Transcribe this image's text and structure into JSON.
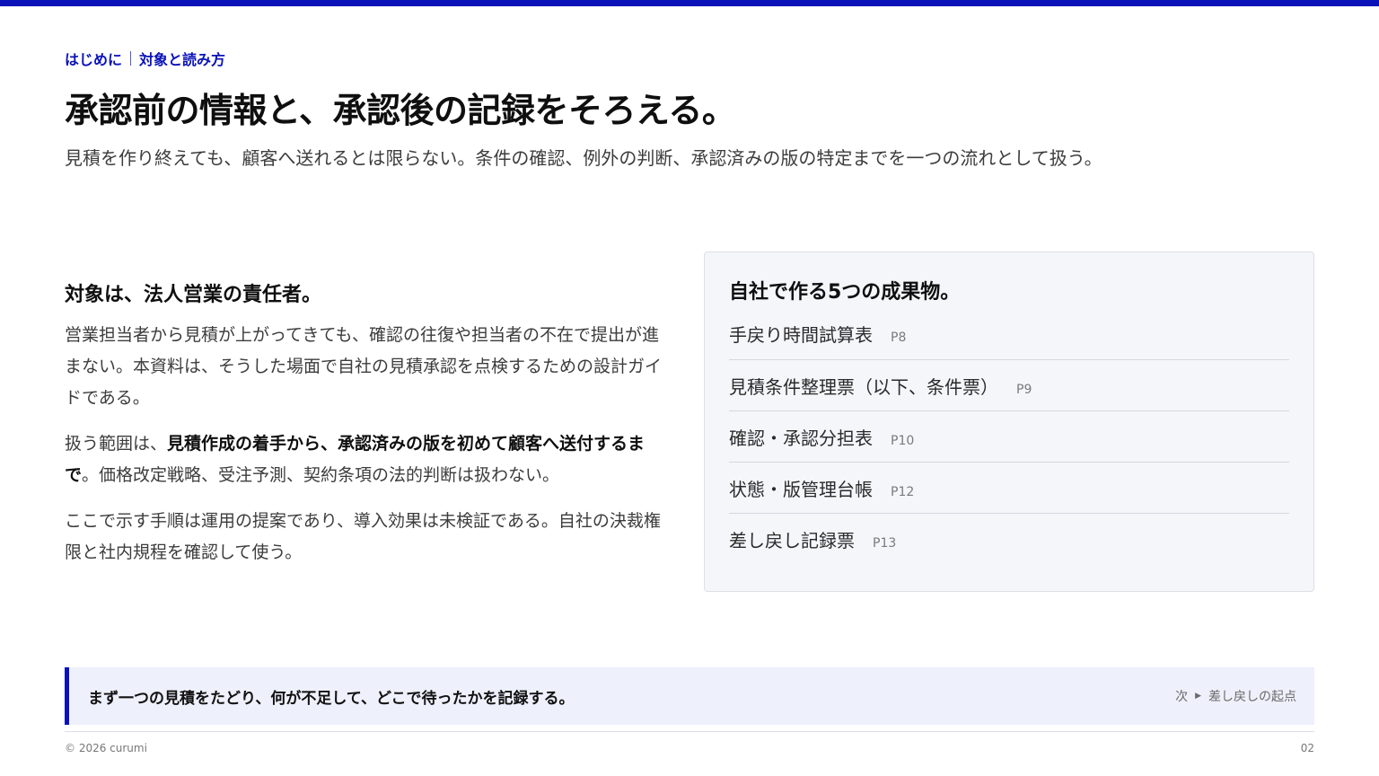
{
  "breadcrumb": {
    "section": "はじめに",
    "topic": "対象と読み方"
  },
  "title": "承認前の情報と、承認後の記録をそろえる。",
  "subtitle": "見積を作り終えても、顧客へ送れるとは限らない。条件の確認、例外の判断、承認済みの版の特定までを一つの流れとして扱う。",
  "audience": {
    "heading": "対象は、法人営業の責任者。",
    "para1": "営業担当者から見積が上がってきても、確認の往復や担当者の不在で提出が進まない。本資料は、そうした場面で自社の見積承認を点検するための設計ガイドである。",
    "para2_pre": "扱う範囲は、",
    "para2_strong": "見積作成の着手から、承認済みの版を初めて顧客へ送付するまで",
    "para2_post": "。価格改定戦略、受注予測、契約条項の法的判断は扱わない。",
    "para3": "ここで示す手順は運用の提案であり、導入効果は未検証である。自社の決裁権限と社内規程を確認して使う。"
  },
  "deliverables": {
    "heading": "自社で作る5つの成果物。",
    "items": [
      {
        "name": "手戻り時間試算表",
        "page": "P8"
      },
      {
        "name": "見積条件整理票（以下、条件票）",
        "page": "P9"
      },
      {
        "name": "確認・承認分担表",
        "page": "P10"
      },
      {
        "name": "状態・版管理台帳",
        "page": "P12"
      },
      {
        "name": "差し戻し記録票",
        "page": "P13"
      }
    ]
  },
  "callout": {
    "message": "まず一つの見積をたどり、何が不足して、どこで待ったかを記録する。",
    "next_label": "次",
    "next_target": "差し戻しの起点"
  },
  "footer": {
    "copyright": "© 2026 curumi",
    "page_number": "02"
  },
  "colors": {
    "accent": "#0a12b8",
    "card_bg": "#f5f6fa",
    "callout_bg": "#eef0fb"
  }
}
